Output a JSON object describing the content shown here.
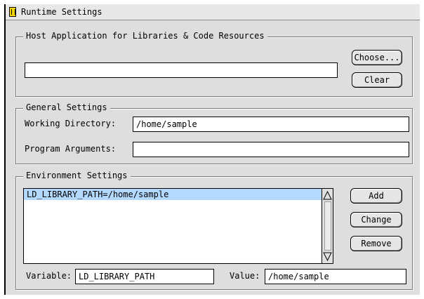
{
  "window": {
    "title": "Runtime Settings"
  },
  "host_group": {
    "label": "Host Application for Libraries & Code Resources",
    "path_value": "",
    "choose_label": "Choose...",
    "clear_label": "Clear"
  },
  "general_group": {
    "label": "General Settings",
    "working_dir_label": "Working Directory:",
    "working_dir_value": "/home/sample",
    "program_args_label": "Program Arguments:",
    "program_args_value": ""
  },
  "env_group": {
    "label": "Environment Settings",
    "items": [
      "LD_LIBRARY_PATH=/home/sample"
    ],
    "selected_index": 0,
    "add_label": "Add",
    "change_label": "Change",
    "remove_label": "Remove",
    "variable_label": "Variable:",
    "variable_value": "LD_LIBRARY_PATH",
    "value_label": "Value:",
    "value_value": "/home/sample"
  },
  "colors": {
    "selection": "#b3d9ff",
    "window_bg": "#dedede"
  },
  "icons": {
    "app": "app-icon",
    "scroll_up": "scroll-up-arrow-icon",
    "scroll_down": "scroll-down-arrow-icon"
  }
}
